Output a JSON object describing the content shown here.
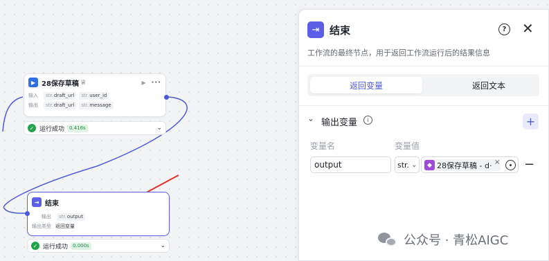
{
  "canvas": {
    "node1": {
      "title": "28保存草稿",
      "title_suffix": "♕",
      "rows": [
        {
          "label": "输入",
          "tags": [
            {
              "type": "str.",
              "name": "draft_url"
            },
            {
              "type": "str.",
              "name": "user_id"
            }
          ]
        },
        {
          "label": "输出",
          "tags": [
            {
              "type": "str.",
              "name": "draft_url"
            },
            {
              "type": "str.",
              "name": "message"
            }
          ]
        }
      ],
      "status": "运行成功",
      "time": "0.416s"
    },
    "node2": {
      "title": "结束",
      "output_label": "输出",
      "output_tag": {
        "type": "str.",
        "name": "output"
      },
      "type_label": "输出类型",
      "type_value": "返回变量",
      "status": "运行成功",
      "time": "0.000s"
    },
    "edge_color": "#4b5bd8",
    "arrow_color": "#e0322a"
  },
  "panel": {
    "title": "结束",
    "description": "工作流的最终节点，用于返回工作流运行后的结果信息",
    "tabs": [
      {
        "label": "返回变量",
        "active": true
      },
      {
        "label": "返回文本",
        "active": false
      }
    ],
    "section_title": "输出变量",
    "col_name": "变量名",
    "col_value": "变量值",
    "row": {
      "name": "output",
      "type": "str.",
      "ref": "28保存草稿 - d·"
    }
  },
  "watermark": "公众号 · 青松AIGC",
  "colors": {
    "accent": "#4e5ae0",
    "node_icon_end": "#5b5fe8",
    "success": "#22a34a"
  }
}
